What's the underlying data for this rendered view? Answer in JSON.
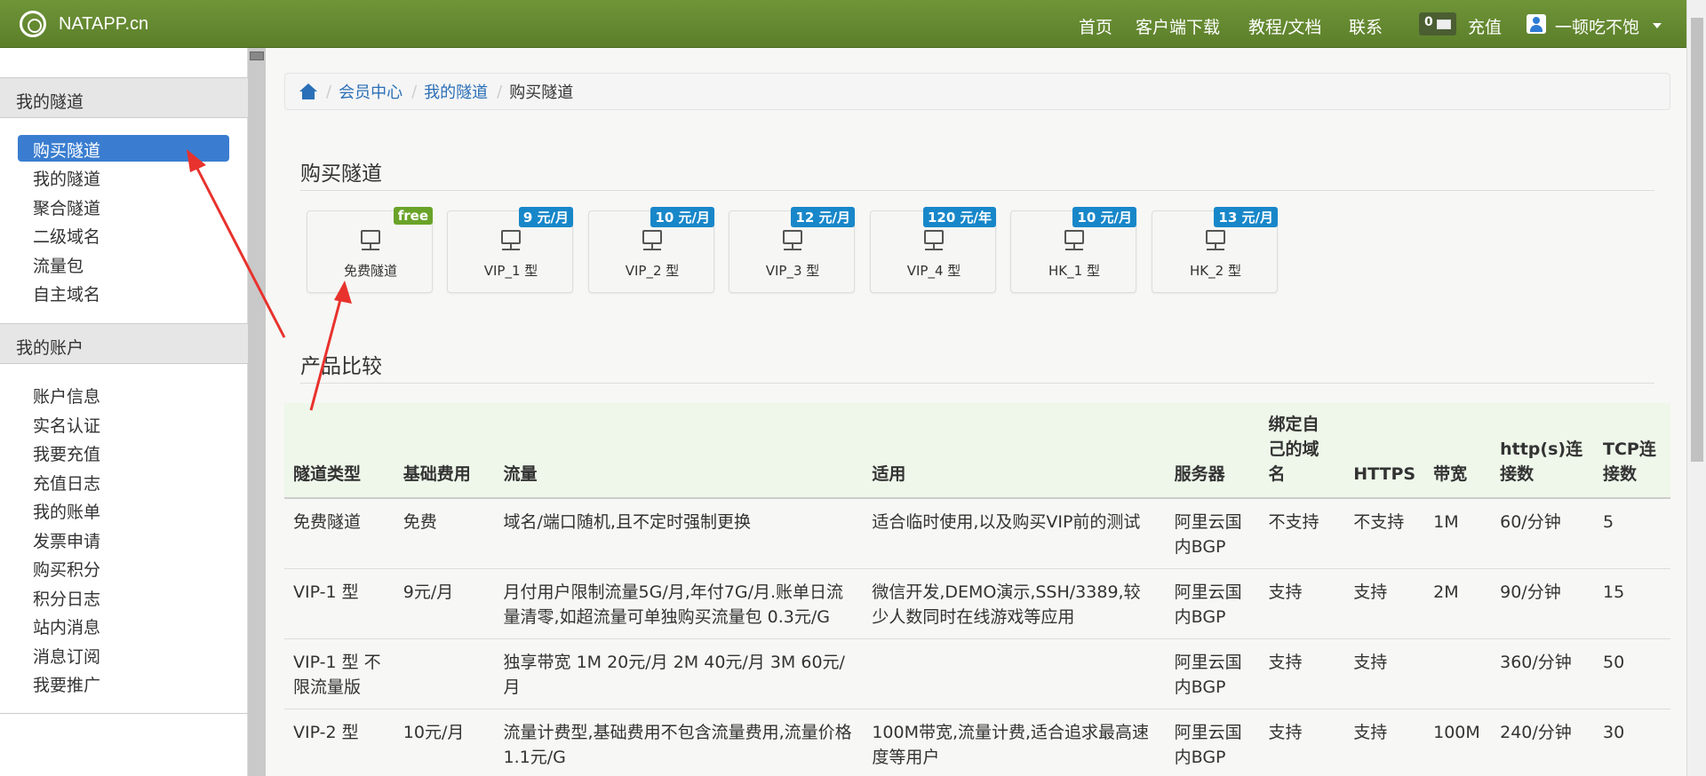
{
  "navbar": {
    "brand": "NATAPP.cn",
    "links": [
      "首页",
      "客户端下载",
      "教程/文档",
      "联系"
    ],
    "message_count": "0",
    "recharge": "充值",
    "username": "一顿吃不饱"
  },
  "sidebar": {
    "section_tunnels": "我的隧道",
    "tunnel_items": [
      "购买隧道",
      "我的隧道",
      "聚合隧道",
      "二级域名",
      "流量包",
      "自主域名"
    ],
    "section_account": "我的账户",
    "account_items": [
      "账户信息",
      "实名认证",
      "我要充值",
      "充值日志",
      "我的账单",
      "发票申请",
      "购买积分",
      "积分日志",
      "站内消息",
      "消息订阅",
      "我要推广"
    ]
  },
  "breadcrumb": {
    "items": [
      "会员中心",
      "我的隧道",
      "购买隧道"
    ]
  },
  "main": {
    "buy_title": "购买隧道",
    "compare_title": "产品比较",
    "products": [
      {
        "name": "免费隧道",
        "badge": "free"
      },
      {
        "name": "VIP_1 型",
        "badge": "9 元/月"
      },
      {
        "name": "VIP_2 型",
        "badge": "10 元/月"
      },
      {
        "name": "VIP_3 型",
        "badge": "12 元/月"
      },
      {
        "name": "VIP_4 型",
        "badge": "120 元/年"
      },
      {
        "name": "HK_1 型",
        "badge": "10 元/月"
      },
      {
        "name": "HK_2 型",
        "badge": "13 元/月"
      }
    ]
  },
  "table": {
    "headers": [
      "隧道类型",
      "基础费用",
      "流量",
      "适用",
      "服务器",
      "绑定自己的域名",
      "HTTPS",
      "带宽",
      "http(s)连接数",
      "TCP连接数"
    ],
    "rows": [
      [
        "免费隧道",
        "免费",
        "域名/端口随机,且不定时强制更换",
        "适合临时使用,以及购买VIP前的测试",
        "阿里云国内BGP",
        "不支持",
        "不支持",
        "1M",
        "60/分钟",
        "5"
      ],
      [
        "VIP-1 型",
        "9元/月",
        "月付用户限制流量5G/月,年付7G/月.账单日流量清零,如超流量可单独购买流量包 0.3元/G",
        "微信开发,DEMO演示,SSH/3389,较少人数同时在线游戏等应用",
        "阿里云国内BGP",
        "支持",
        "支持",
        "2M",
        "90/分钟",
        "15"
      ],
      [
        "VIP-1 型 不限流量版",
        "",
        "独享带宽 1M 20元/月 2M 40元/月 3M 60元/月",
        "",
        "阿里云国内BGP",
        "支持",
        "支持",
        "",
        "360/分钟",
        "50"
      ],
      [
        "VIP-2 型",
        "10元/月",
        "流量计费型,基础费用不包含流量费用,流量价格1.1元/G",
        "100M带宽,流量计费,适合追求最高速度等用户",
        "阿里云国内BGP",
        "支持",
        "支持",
        "100M",
        "240/分钟",
        "30"
      ]
    ]
  },
  "colors": {
    "navbar": "#6a8e35",
    "active": "#3a7dd0",
    "badge": "#1887c9",
    "free_badge": "#6aa329",
    "arrow": "#e8322d"
  }
}
